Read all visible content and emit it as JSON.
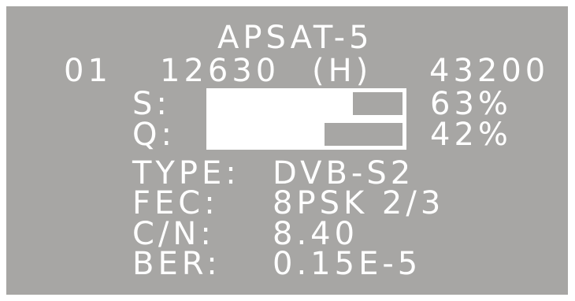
{
  "colors": {
    "background": "#a7a6a4",
    "foreground": "#ffffff",
    "page": "#ffffff"
  },
  "satellite": "APSAT-5",
  "channel": "01",
  "frequency": "12630",
  "polarization": "(H)",
  "symbol_rate": "43200",
  "signal": {
    "s_label": "S:",
    "s_percent": "63%",
    "s_value": 0.63,
    "q_label": "Q:",
    "q_percent": "42%",
    "q_value": 0.42
  },
  "info": {
    "type_label": "TYPE:",
    "type_value": "DVB-S2",
    "fec_label": "FEC:",
    "fec_value": "8PSK 2/3",
    "cn_label": "C/N:",
    "cn_value": "8.40",
    "ber_label": "BER:",
    "ber_value": "0.15E-5"
  }
}
